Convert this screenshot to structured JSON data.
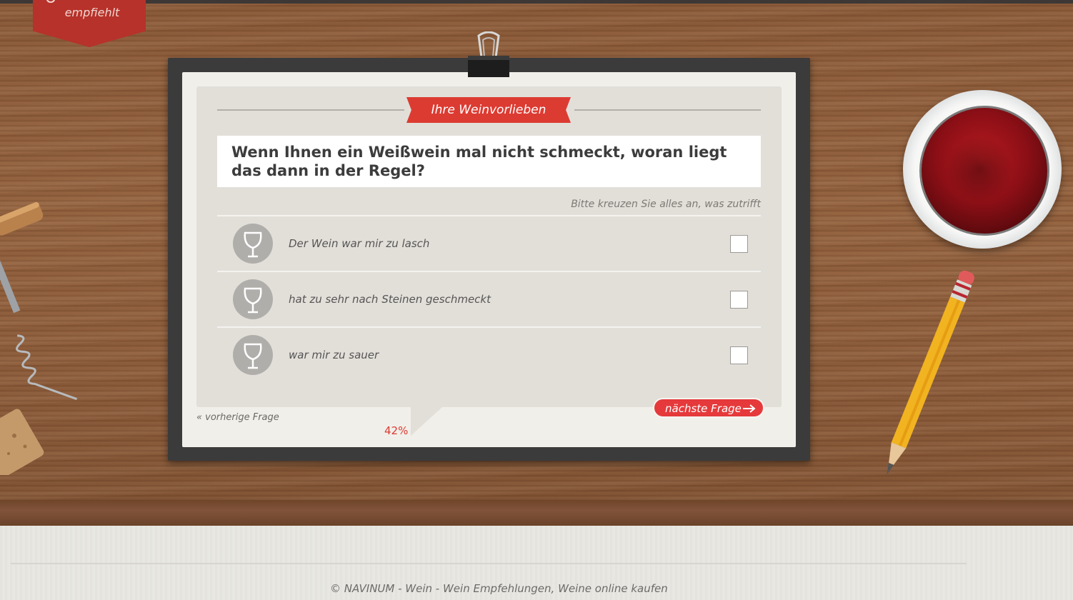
{
  "brand": {
    "ribbon_text": "empfiehlt"
  },
  "quiz": {
    "section_title": "Ihre Weinvorlieben",
    "question": "Wenn Ihnen ein Weißwein mal nicht schmeckt, woran liegt das dann in der Regel?",
    "hint": "Bitte kreuzen Sie alles an, was zutrifft",
    "options": [
      {
        "label": "Der Wein war mir zu lasch",
        "checked": false,
        "icon": "wine-glass-icon"
      },
      {
        "label": "hat zu sehr nach Steinen geschmeckt",
        "checked": false,
        "icon": "wine-glass-icon"
      },
      {
        "label": "war mir zu sauer",
        "checked": false,
        "icon": "wine-glass-icon"
      }
    ],
    "prev_label": "« vorherige Frage",
    "progress_text": "42%",
    "progress_value": 0.42,
    "next_label": "nächste Frage"
  },
  "footer": {
    "text": "© NAVINUM - Wein - Wein Empfehlungen, Weine online kaufen"
  },
  "colors": {
    "accent": "#dc3b32",
    "button": "#e5393b",
    "board": "#3b3b3b",
    "paper": "#f1efea"
  }
}
